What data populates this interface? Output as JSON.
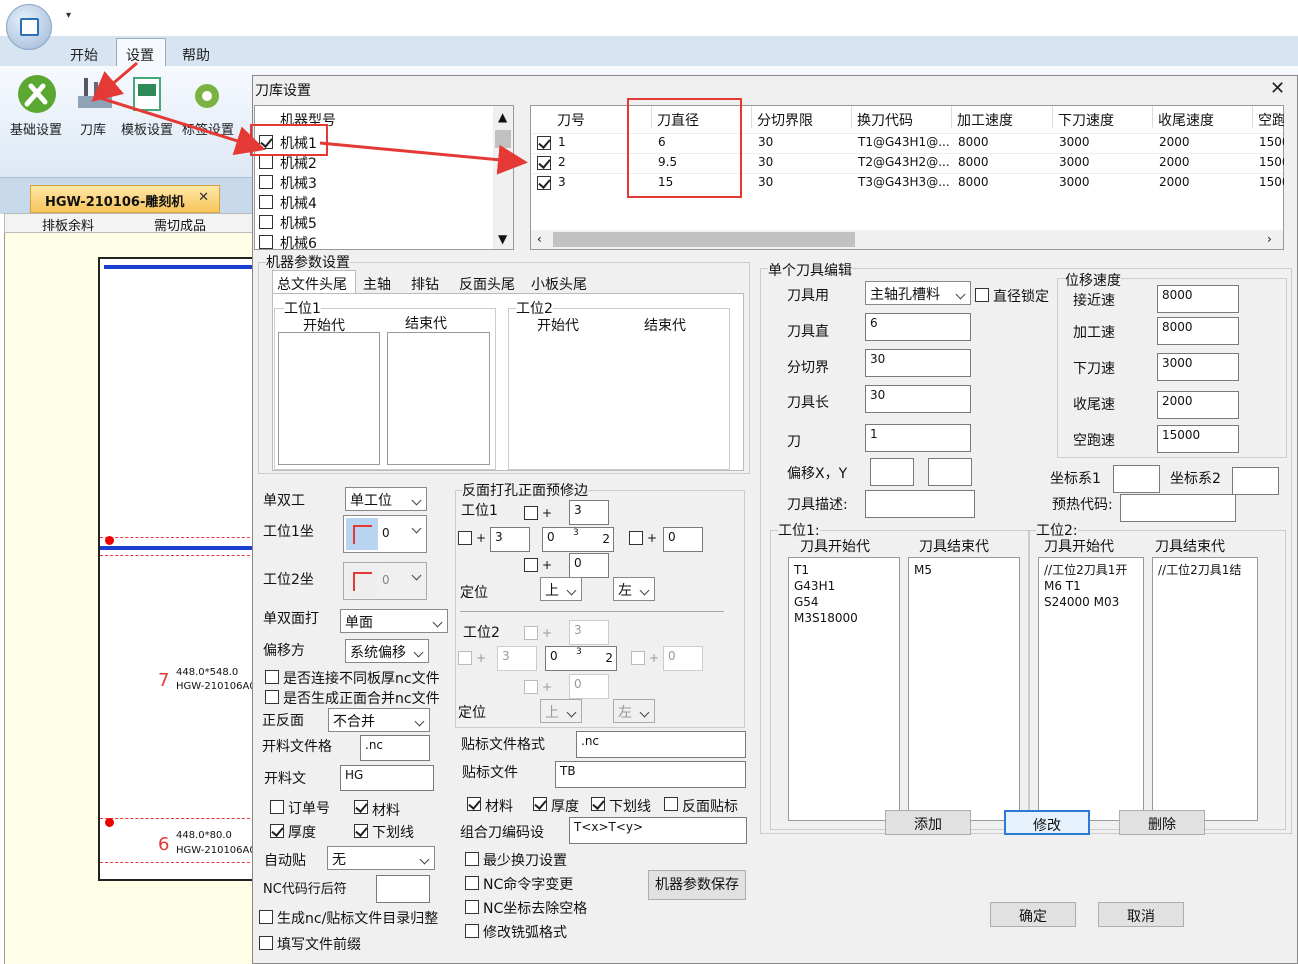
{
  "app": {
    "quick_access": "▾"
  },
  "ribbon": {
    "tabs": [
      "开始",
      "设置",
      "帮助"
    ],
    "buttons": [
      "基础设置",
      "刀库",
      "模板设置",
      "标签设置"
    ]
  },
  "document": {
    "tab_title": "HGW-210106-雕刻机",
    "tab_close": "✕",
    "subtabs": [
      "排板余料",
      "需切成品"
    ],
    "parts": [
      {
        "num": "7",
        "size": "448.0*548.0",
        "name": "HGW-210106A0"
      },
      {
        "num": "6",
        "size": "448.0*80.0",
        "name": "HGW-210106A0"
      }
    ]
  },
  "dialog": {
    "title": "刀库设置",
    "close": "✕",
    "machine_list": {
      "header": "机器型号",
      "items": [
        {
          "label": "机械1",
          "checked": true
        },
        {
          "label": "机械2",
          "checked": false
        },
        {
          "label": "机械3",
          "checked": false
        },
        {
          "label": "机械4",
          "checked": false
        },
        {
          "label": "机械5",
          "checked": false
        },
        {
          "label": "机械6",
          "checked": false
        }
      ]
    },
    "tool_grid": {
      "headers": [
        "刀号",
        "刀直径",
        "分切界限",
        "换刀代码",
        "加工速度",
        "下刀速度",
        "收尾速度",
        "空跑"
      ],
      "rows": [
        [
          "1",
          "6",
          "30",
          "T1@G43H1@...",
          "8000",
          "3000",
          "2000",
          "1500"
        ],
        [
          "2",
          "9.5",
          "30",
          "T2@G43H2@...",
          "8000",
          "3000",
          "2000",
          "1500"
        ],
        [
          "3",
          "15",
          "30",
          "T3@G43H3@...",
          "8000",
          "3000",
          "2000",
          "1500"
        ]
      ]
    },
    "machine_params": {
      "title": "机器参数设置",
      "tabs": [
        "总文件头尾",
        "主轴",
        "排钻",
        "反面头尾",
        "小板头尾"
      ],
      "station1": "工位1",
      "station2": "工位2",
      "start_code": "开始代",
      "end_code": "结束代"
    },
    "left_form": {
      "single_double": "单双工",
      "single_double_val": "单工位",
      "st1_coord": "工位1坐",
      "st2_coord": "工位2坐",
      "coord_val": "0",
      "face": "单双面打",
      "face_val": "单面",
      "offset": "偏移方",
      "offset_val": "系统偏移",
      "conn_nc": "是否连接不同板厚nc文件",
      "merge_nc": "是否生成正面合并nc文件",
      "front_back": "正反面",
      "front_back_val": "不合并",
      "cut_format": "开料文件格",
      "cut_format_val": ".nc",
      "cut_file": "开料文",
      "cut_file_val": "HG",
      "order_no": "订单号",
      "material": "材料",
      "thickness": "厚度",
      "underline": "下划线",
      "auto_label": "自动贴",
      "auto_label_val": "无",
      "nc_line": "NC代码行后符",
      "gen_dir": "生成nc/贴标文件目录归整",
      "fill_prefix": "填写文件前缀"
    },
    "reverse": {
      "title": "反面打孔正面预修边",
      "st1": "工位1",
      "st2": "工位2",
      "v3": "3",
      "v0": "0",
      "mid": "3",
      "pos": "定位",
      "up": "上",
      "left": "左"
    },
    "label_form": {
      "label_format": "贴标文件格式",
      "label_format_val": ".nc",
      "label_file": "贴标文件",
      "label_file_val": "TB",
      "material": "材料",
      "thickness": "厚度",
      "underline": "下划线",
      "reverse_label": "反面贴标",
      "combo_code": "组合刀编码设",
      "combo_val": "T<x>T<y>",
      "min_change": "最少换刀设置",
      "nc_cmd": "NC命令字变更",
      "nc_space": "NC坐标去除空格",
      "arc_fmt": "修改铣弧格式",
      "save_btn": "机器参数保存"
    },
    "single_tool": {
      "title": "单个刀具编辑",
      "use": "刀具用",
      "use_val": "主轴孔槽料",
      "dia_lock": "直径锁定",
      "dia": "刀具直",
      "dia_val": "6",
      "split": "分切界",
      "split_val": "30",
      "len": "刀具长",
      "len_val": "30",
      "knife": "刀",
      "knife_val": "1",
      "offset": "偏移X，Y",
      "desc": "刀具描述:",
      "speed_title": "位移速度",
      "approach": "接近速",
      "approach_val": "8000",
      "process": "加工速",
      "process_val": "8000",
      "down": "下刀速",
      "down_val": "3000",
      "tail": "收尾速",
      "tail_val": "2000",
      "idle": "空跑速",
      "idle_val": "15000",
      "coord1": "坐标系1",
      "coord2": "坐标系2",
      "preheat": "预热代码:",
      "st1": "工位1:",
      "st2": "工位2:",
      "tool_start": "刀具开始代",
      "tool_end": "刀具结束代",
      "st1_start": [
        "T1",
        "G43H1",
        "G54",
        "M3S18000"
      ],
      "st1_end": [
        "M5"
      ],
      "st2_start": [
        "//工位2刀具1开",
        "M6 T1",
        "S24000 M03"
      ],
      "st2_end": [
        "//工位2刀具1结"
      ]
    },
    "buttons": {
      "add": "添加",
      "modify": "修改",
      "delete": "删除",
      "ok": "确定",
      "cancel": "取消"
    }
  }
}
